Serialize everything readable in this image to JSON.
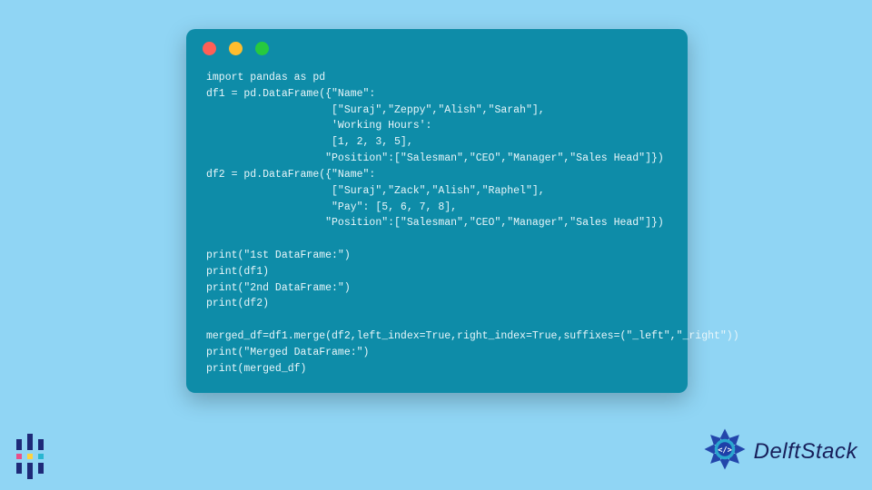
{
  "code_window": {
    "traffic_lights": [
      "red",
      "yellow",
      "green"
    ],
    "code": "import pandas as pd\ndf1 = pd.DataFrame({\"Name\":\n                    [\"Suraj\",\"Zeppy\",\"Alish\",\"Sarah\"],\n                    'Working Hours':\n                    [1, 2, 3, 5],\n                   \"Position\":[\"Salesman\",\"CEO\",\"Manager\",\"Sales Head\"]})\ndf2 = pd.DataFrame({\"Name\":\n                    [\"Suraj\",\"Zack\",\"Alish\",\"Raphel\"],\n                    \"Pay\": [5, 6, 7, 8],\n                   \"Position\":[\"Salesman\",\"CEO\",\"Manager\",\"Sales Head\"]})\n\nprint(\"1st DataFrame:\")\nprint(df1)\nprint(\"2nd DataFrame:\")\nprint(df2)\n\nmerged_df=df1.merge(df2,left_index=True,right_index=True,suffixes=(\"_left\",\"_right\"))\nprint(\"Merged DataFrame:\")\nprint(merged_df)"
  },
  "brand": {
    "name": "DelftStack"
  }
}
